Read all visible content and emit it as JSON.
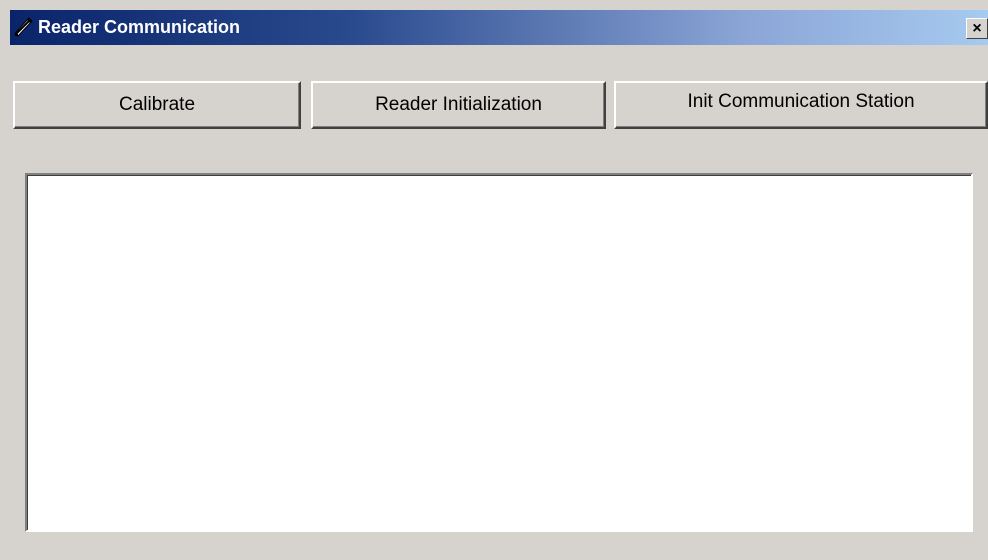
{
  "window": {
    "title": "Reader Communication",
    "title_icon": "pen-icon",
    "close_label": "×"
  },
  "buttons": {
    "calibrate_label": "Calibrate",
    "reader_init_label": "Reader Initialization",
    "init_station_label": "Init Communication Station"
  },
  "log": {
    "content": ""
  },
  "colors": {
    "title_gradient_start": "#0a246a",
    "title_gradient_end": "#a6caf0",
    "window_background": "#d6d3ce",
    "text_area_background": "#ffffff"
  }
}
